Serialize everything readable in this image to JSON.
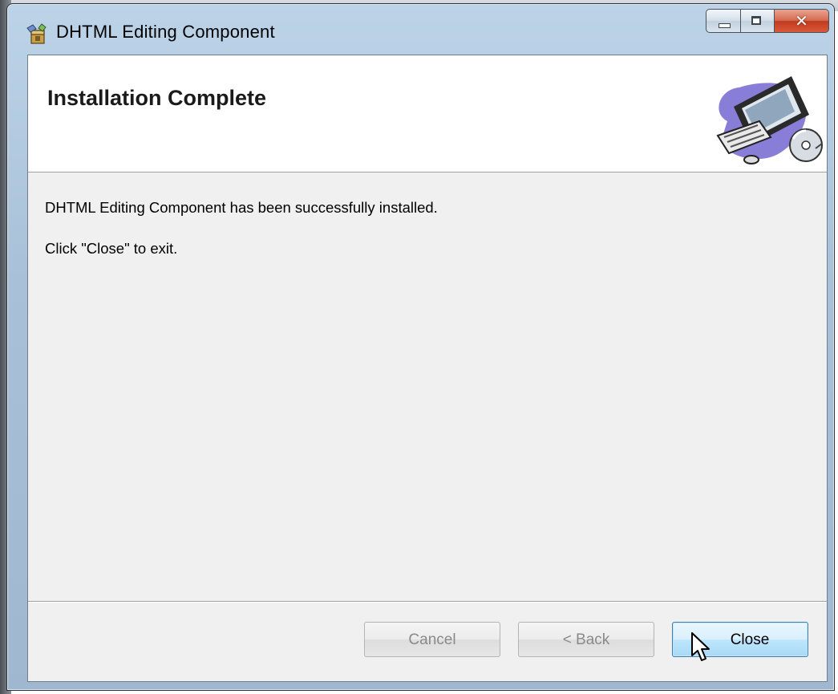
{
  "window": {
    "title": "DHTML Editing Component",
    "title_icon": "installer-package-icon",
    "caption_buttons": [
      "minimize",
      "maximize",
      "close"
    ]
  },
  "banner": {
    "heading": "Installation Complete",
    "art_icon": "computer-with-cd-illustration"
  },
  "body": {
    "message": "DHTML Editing Component has been successfully installed.",
    "instruction": "Click \"Close\" to exit."
  },
  "buttons": {
    "cancel_label": "Cancel",
    "back_label": "< Back",
    "close_label": "Close"
  },
  "colors": {
    "close_accent": "#c23a1f",
    "button_focus": "#3c7fb1",
    "client_bg": "#f0f0f0"
  }
}
